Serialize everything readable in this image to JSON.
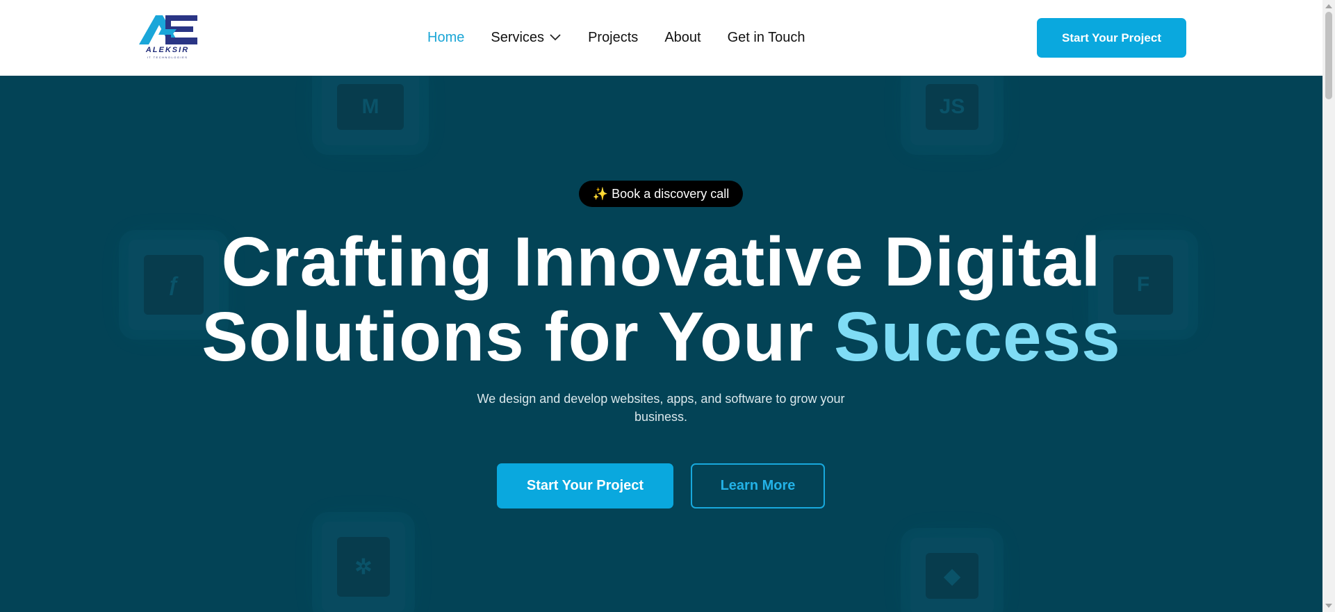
{
  "brand": {
    "name": "ALEKSIR",
    "tagline": "IT TECHNOLOGIES",
    "primary_color": "#0aa8de",
    "dark_color": "#034356",
    "accent_text_color": "#7fdcf5",
    "logo_color": "#1f2a78"
  },
  "nav": {
    "items": [
      {
        "label": "Home",
        "active": true
      },
      {
        "label": "Services",
        "has_dropdown": true
      },
      {
        "label": "Projects"
      },
      {
        "label": "About"
      },
      {
        "label": "Get in Touch"
      }
    ],
    "cta_label": "Start Your Project"
  },
  "hero": {
    "badge_icon": "sparkles-icon",
    "badge_label": "✨ Book a discovery call",
    "headline_line1": "Crafting Innovative Digital",
    "headline_line2_part1": "Solutions for Your ",
    "headline_line2_accent": "Success",
    "subtitle": "We design and develop websites, apps, and software to grow your business.",
    "primary_button": "Start Your Project",
    "secondary_button": "Learn More",
    "background_icons": [
      "mui-icon",
      "javascript-icon",
      "flutter-icon",
      "figma-icon",
      "openai-icon",
      "git-icon"
    ]
  }
}
